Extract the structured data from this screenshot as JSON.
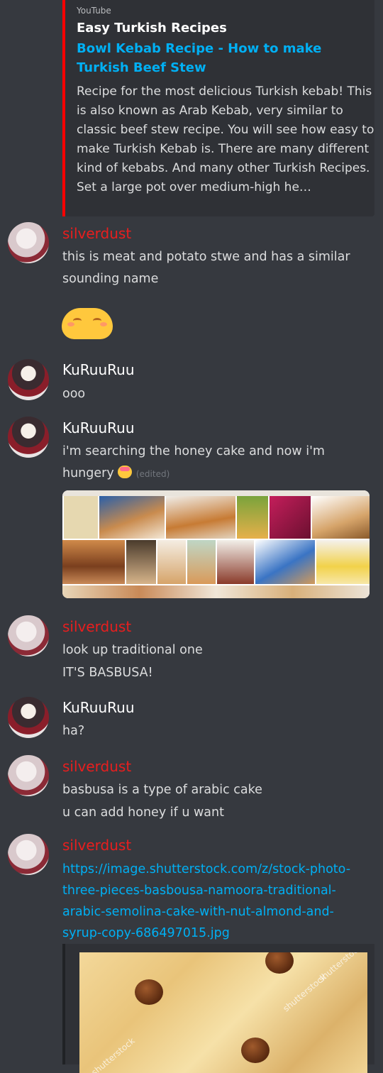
{
  "embed": {
    "provider": "YouTube",
    "author": "Easy Turkish Recipes",
    "title": "Bowl Kebab Recipe - How to make Turkish Beef Stew",
    "description": "Recipe for the most delicious Turkish kebab! This is also known as Arab Kebab, very similar to classic beef stew recipe. You will see how easy to make Turkish Kebab is. There are many different kind of kebabs. And many other Turkish Recipes. Set a large pot over medium-high he…",
    "accent_color": "#ff0000"
  },
  "messages": [
    {
      "author": "silverdust",
      "author_color": "#e91e1e",
      "lines": [
        "this is meat and potato stwe and has a similar",
        "sounding name"
      ],
      "emoji": "blush-emoji"
    },
    {
      "author": "KuRuuRuu",
      "author_color": "#ffffff",
      "lines": [
        "ooo"
      ]
    },
    {
      "author": "KuRuuRuu",
      "author_color": "#ffffff",
      "lines": [
        "i'm searching the honey cake and now i'm",
        "hungery"
      ],
      "edited": "(edited)",
      "inline_emoji": "drooling-emoji"
    },
    {
      "author": "silverdust",
      "author_color": "#e91e1e",
      "lines": [
        "look up traditional one",
        "IT'S BASBUSA!"
      ]
    },
    {
      "author": "KuRuuRuu",
      "author_color": "#ffffff",
      "lines": [
        "ha?"
      ]
    },
    {
      "author": "silverdust",
      "author_color": "#e91e1e",
      "lines": [
        "basbusa is a type of arabic cake",
        "u can add honey if u want"
      ]
    },
    {
      "author": "silverdust",
      "author_color": "#e91e1e",
      "link": [
        "https://image.shutterstock.com/z/stock-photo-",
        "three-pieces-basbousa-namoora-traditional-",
        "arabic-semolina-cake-with-nut-almond-and-",
        "syrup-copy-686497015.jpg"
      ],
      "watermark": "shutterstock"
    }
  ]
}
